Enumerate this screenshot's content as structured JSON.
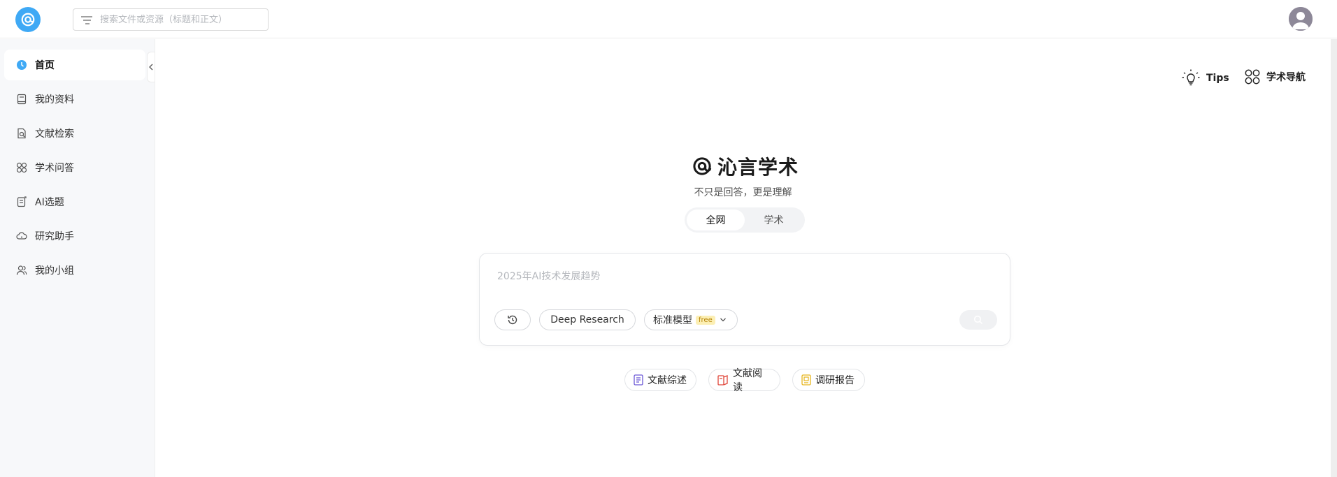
{
  "header": {
    "search_placeholder": "搜索文件或资源（标题和正文）",
    "icons": {
      "logo": "at-sign-logo",
      "filter": "filter-lines-icon",
      "avatar": "user-avatar"
    }
  },
  "sidebar": {
    "items": [
      {
        "label": "首页",
        "icon": "clock-icon",
        "active": true
      },
      {
        "label": "我的资料",
        "icon": "book-icon",
        "active": false
      },
      {
        "label": "文献检索",
        "icon": "doc-search-icon",
        "active": false
      },
      {
        "label": "学术问答",
        "icon": "grid-circles-icon",
        "active": false
      },
      {
        "label": "AI选题",
        "icon": "doc-edit-icon",
        "active": false
      },
      {
        "label": "研究助手",
        "icon": "cloud-icon",
        "active": false
      },
      {
        "label": "我的小组",
        "icon": "group-icon",
        "active": false
      }
    ]
  },
  "main": {
    "tips_label": "Tips",
    "nav_label": "学术导航",
    "brand_title": "沁言学术",
    "brand_subtitle": "不只是回答，更是理解",
    "modes": [
      {
        "label": "全网",
        "active": true
      },
      {
        "label": "学术",
        "active": false
      }
    ],
    "query_placeholder": "2025年AI技术发展趋势",
    "deep_research_label": "Deep Research",
    "model_label": "标准模型",
    "model_badge": "free",
    "quick_actions": [
      {
        "label": "文献综述",
        "icon": "list-doc-icon",
        "color": "#6b57d6"
      },
      {
        "label": "文献阅读",
        "icon": "open-doc-icon",
        "color": "#e0463a"
      },
      {
        "label": "调研报告",
        "icon": "report-icon",
        "color": "#e6b51b"
      }
    ]
  },
  "colors": {
    "accent": "#3fa9f5",
    "sidebar_bg": "#f7f8fa",
    "badge_bg": "#fcefb4"
  }
}
